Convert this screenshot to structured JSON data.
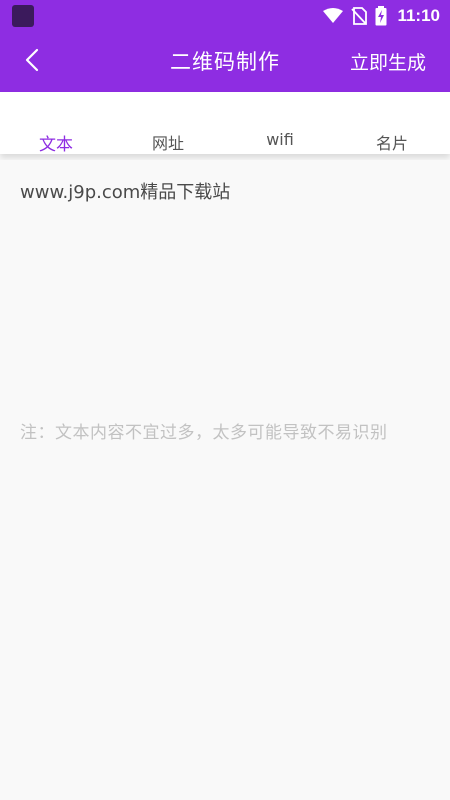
{
  "status_bar": {
    "time": "11:10",
    "icons": [
      "app-icon",
      "wifi-icon",
      "no-sim-icon",
      "battery-charging-icon"
    ]
  },
  "toolbar": {
    "title": "二维码制作",
    "generate_label": "立即生成",
    "back_icon": "chevron-left-icon"
  },
  "tabs": [
    {
      "label": "文本",
      "active": true
    },
    {
      "label": "网址",
      "active": false
    },
    {
      "label": "wifi",
      "active": false
    },
    {
      "label": "名片",
      "active": false
    }
  ],
  "content": {
    "text_value": "www.j9p.com精品下载站",
    "note": "注：文本内容不宜过多，太多可能导致不易识别"
  },
  "colors": {
    "accent": "#8e2de2",
    "background": "#f9f9f9",
    "note_text": "#c2c2c2"
  }
}
